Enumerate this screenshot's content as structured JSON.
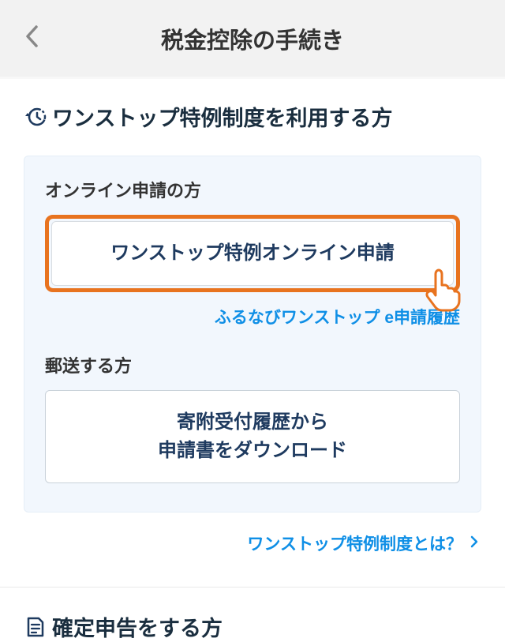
{
  "header": {
    "title": "税金控除の手続き"
  },
  "section1": {
    "title": "ワンストップ特例制度を利用する方",
    "online": {
      "label": "オンライン申請の方",
      "button": "ワンストップ特例オンライン申請",
      "history_link": "ふるなびワンストップ e申請履歴"
    },
    "mail": {
      "label": "郵送する方",
      "button_line1": "寄附受付履歴から",
      "button_line2": "申請書をダウンロード"
    },
    "about_link": "ワンストップ特例制度とは？"
  },
  "section2": {
    "title": "確定申告をする方"
  }
}
